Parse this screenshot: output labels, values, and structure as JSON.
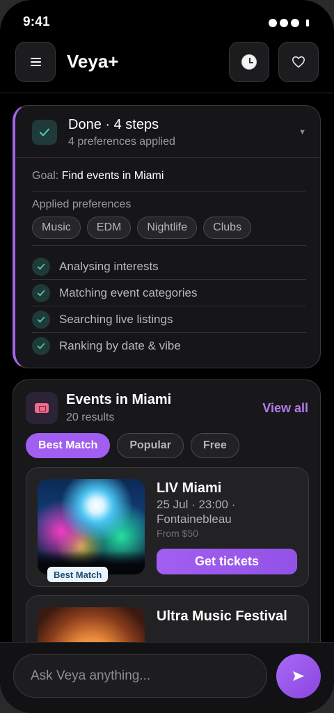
{
  "status_bar": {
    "time": "9:41"
  },
  "header": {
    "title": "Veya+"
  },
  "progress": {
    "title": "Done · 4 steps",
    "subtitle": "4 preferences applied",
    "goal_label": "Goal:",
    "goal_value": "Find events in Miami",
    "prefs_label": "Applied preferences",
    "preferences": [
      "Music",
      "EDM",
      "Nightlife",
      "Clubs"
    ],
    "steps": [
      "Analysing interests",
      "Matching event categories",
      "Searching live listings",
      "Ranking by date & vibe"
    ]
  },
  "events": {
    "title": "Events in Miami",
    "count": "20 results",
    "view_all": "View all",
    "filters": [
      "Best Match",
      "Popular",
      "Free"
    ],
    "active_filter": "Best Match",
    "items": [
      {
        "name": "LIV Miami",
        "date": "25 Jul · 23:00 ·",
        "venue": "Fontainebleau",
        "price": "From $50",
        "badge": "Best Match",
        "cta": "Get tickets"
      },
      {
        "name": "Ultra Music Festival"
      }
    ]
  },
  "composer": {
    "placeholder": "Ask Veya anything..."
  },
  "colors": {
    "accent": "#a05ff0",
    "check": "#4fd1b3",
    "background": "#000000"
  }
}
